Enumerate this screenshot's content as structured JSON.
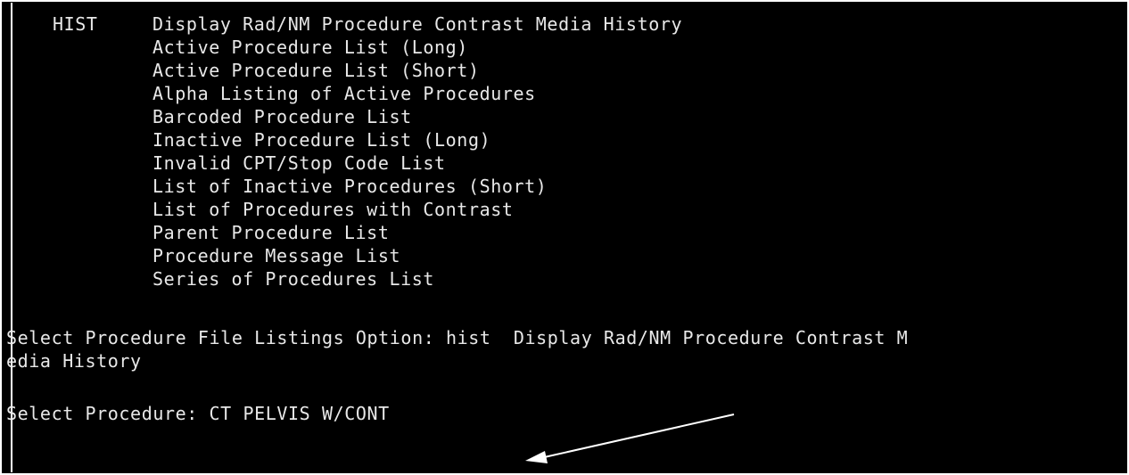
{
  "menu": {
    "code": "HIST",
    "items": [
      "Display Rad/NM Procedure Contrast Media History",
      "Active Procedure List (Long)",
      "Active Procedure List (Short)",
      "Alpha Listing of Active Procedures",
      "Barcoded Procedure List",
      "Inactive Procedure List (Long)",
      "Invalid CPT/Stop Code List",
      "List of Inactive Procedures (Short)",
      "List of Procedures with Contrast",
      "Parent Procedure List",
      "Procedure Message List",
      "Series of Procedures List"
    ]
  },
  "prompts": {
    "option_line_1": "Select Procedure File Listings Option: hist  Display Rad/NM Procedure Contrast M",
    "option_line_2": "edia History",
    "procedure_line": "Select Procedure: CT PELVIS W/CONT"
  },
  "colors": {
    "background": "#000000",
    "text": "#e8e8e8",
    "annotation_arrow": "#ffffff"
  }
}
